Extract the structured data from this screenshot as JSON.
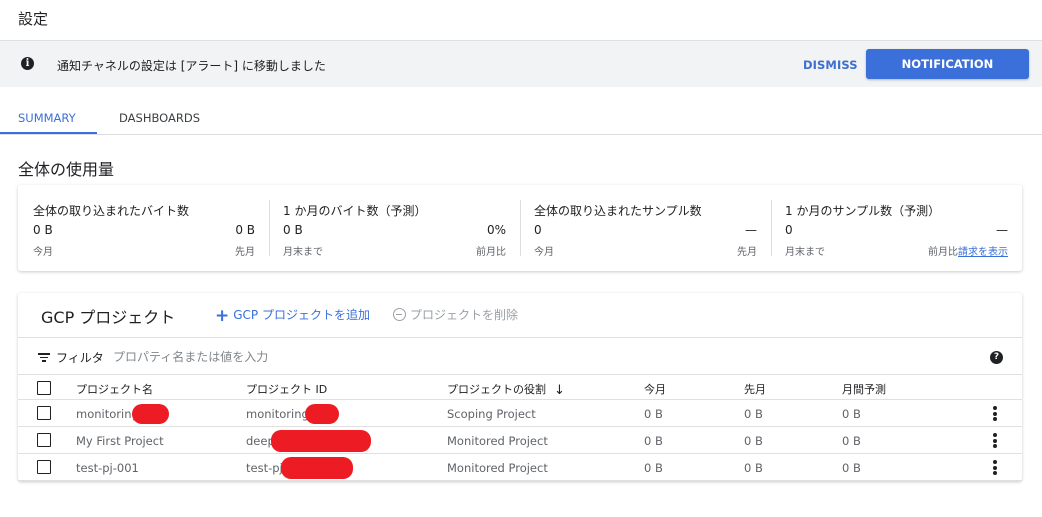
{
  "page_title": "設定",
  "banner": {
    "message": "通知チャネルの設定は [アラート] に移動しました",
    "dismiss_label": "DISMISS",
    "notification_channels_label": "NOTIFICATION CHANNELS"
  },
  "tabs": [
    {
      "label": "SUMMARY",
      "active": true
    },
    {
      "label": "DASHBOARDS",
      "active": false
    }
  ],
  "usage": {
    "title": "全体の使用量",
    "metrics": [
      {
        "title": "全体の取り込まれたバイト数",
        "left_value": "0 B",
        "left_sub": "今月",
        "right_value": "0 B",
        "right_sub": "先月"
      },
      {
        "title": "1 か月のバイト数（予測）",
        "left_value": "0 B",
        "left_sub": "月末まで",
        "right_value": "0%",
        "right_sub": "前月比"
      },
      {
        "title": "全体の取り込まれたサンプル数",
        "left_value": "0",
        "left_sub": "今月",
        "right_value": "—",
        "right_sub": "先月"
      },
      {
        "title": "1 か月のサンプル数（予測）",
        "left_value": "0",
        "left_sub": "月末まで",
        "right_value": "—",
        "right_sub": "前月比",
        "right_link": "請求を表示"
      }
    ]
  },
  "projects": {
    "title": "GCP プロジェクト",
    "add_label": "GCP プロジェクトを追加",
    "delete_label": "プロジェクトを削除",
    "filter_label": "フィルタ",
    "filter_placeholder": "プロパティ名または値を入力",
    "columns": [
      "プロジェクト名",
      "プロジェクト ID",
      "プロジェクトの役割",
      "今月",
      "先月",
      "月間予測"
    ],
    "rows": [
      {
        "name": "monitoring-",
        "id": "monitoring-",
        "role": "Scoping Project",
        "this_month": "0 B",
        "last_month": "0 B",
        "forecast": "0 B"
      },
      {
        "name": "My First Project",
        "id": "deep",
        "role": "Monitored Project",
        "this_month": "0 B",
        "last_month": "0 B",
        "forecast": "0 B"
      },
      {
        "name": "test-pj-001",
        "id": "test-pj-",
        "role": "Monitored Project",
        "this_month": "0 B",
        "last_month": "0 B",
        "forecast": "0 B"
      }
    ]
  },
  "colors": {
    "accent": "#3b6fd9",
    "redaction": "#ed1c24"
  }
}
